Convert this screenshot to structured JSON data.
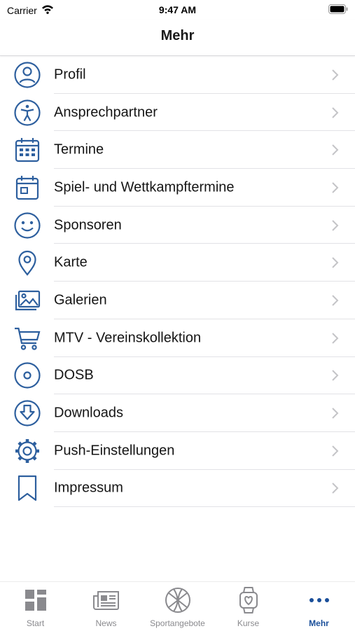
{
  "status_bar": {
    "carrier": "Carrier",
    "time": "9:47 AM"
  },
  "nav": {
    "title": "Mehr"
  },
  "colors": {
    "accent": "#2d5f9e",
    "active_tab": "#1a4f9a",
    "inactive_tab": "#8a8a8e"
  },
  "menu": {
    "items": [
      {
        "label": "Profil",
        "icon": "user-circle-icon"
      },
      {
        "label": "Ansprechpartner",
        "icon": "accessibility-icon"
      },
      {
        "label": "Termine",
        "icon": "calendar-icon"
      },
      {
        "label": "Spiel- und Wettkampftermine",
        "icon": "calendar-event-icon"
      },
      {
        "label": "Sponsoren",
        "icon": "smiley-icon"
      },
      {
        "label": "Karte",
        "icon": "map-pin-icon"
      },
      {
        "label": "Galerien",
        "icon": "gallery-icon"
      },
      {
        "label": "MTV - Vereinskollektion",
        "icon": "cart-icon"
      },
      {
        "label": "DOSB",
        "icon": "disc-icon"
      },
      {
        "label": "Downloads",
        "icon": "download-circle-icon"
      },
      {
        "label": "Push-Einstellungen",
        "icon": "gear-icon"
      },
      {
        "label": "Impressum",
        "icon": "bookmark-icon"
      }
    ]
  },
  "tabs": [
    {
      "label": "Start",
      "icon": "dashboard-icon",
      "active": false
    },
    {
      "label": "News",
      "icon": "newspaper-icon",
      "active": false
    },
    {
      "label": "Sportangebote",
      "icon": "basketball-icon",
      "active": false
    },
    {
      "label": "Kurse",
      "icon": "watch-icon",
      "active": false
    },
    {
      "label": "Mehr",
      "icon": "more-dots-icon",
      "active": true
    }
  ]
}
